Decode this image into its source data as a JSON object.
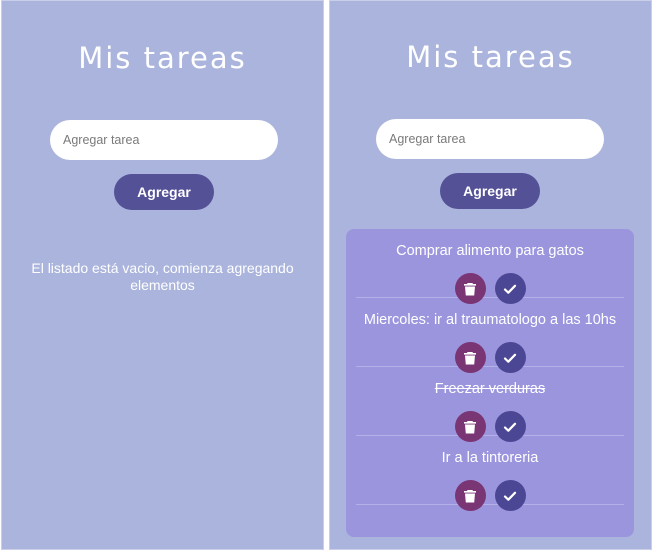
{
  "left": {
    "title": "Mis tareas",
    "input_placeholder": "Agregar tarea",
    "add_label": "Agregar",
    "empty_message": "El listado está vacio, comienza agregando elementos"
  },
  "right": {
    "title": "Mis tareas",
    "input_placeholder": "Agregar tarea",
    "add_label": "Agregar",
    "tasks": [
      {
        "text": "Comprar alimento para gatos",
        "done": false
      },
      {
        "text": "Miercoles: ir al traumatologo a las 10hs",
        "done": false
      },
      {
        "text": "Freezar verduras",
        "done": true
      },
      {
        "text": "Ir a la tintoreria",
        "done": false
      }
    ]
  },
  "icons": {
    "delete": "trash-icon",
    "complete": "check-icon"
  },
  "colors": {
    "background": "#aab4dc",
    "button": "#545197",
    "list_background": "#9b95de",
    "delete_button": "#7a3574",
    "check_button": "#4c4794"
  }
}
